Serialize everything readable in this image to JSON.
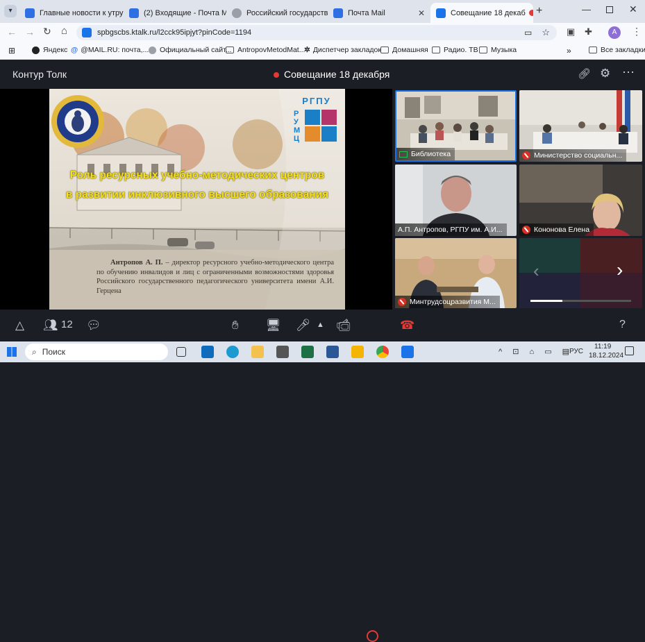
{
  "browser": {
    "tabs": [
      {
        "title": "Главные новости к утру",
        "color": "#2f6fe4",
        "active": false
      },
      {
        "title": "(2) Входящие - Почта M",
        "color": "#2f6fe4",
        "active": false
      },
      {
        "title": "Российский государстве",
        "color": "#888",
        "active": false
      },
      {
        "title": "Почта Mail",
        "color": "#2f6fe4",
        "active": false
      },
      {
        "title": "Совещание 18 декаб",
        "color": "#1a73e8",
        "active": true
      }
    ],
    "url": "spbgscbs.ktalk.ru/l2cck95ipjyt?pinCode=1194",
    "profile_initial": "A",
    "bookmarks": [
      "Яндекс",
      "@MAIL.RU: почта,...",
      "Официальный сайт...",
      "AntropovMetodMat...",
      "Диспетчер закладок",
      "Домашняя",
      "Радио. ТВ",
      "Музыка"
    ],
    "bookmarks_overflow": "»",
    "all_bookmarks": "Все закладки"
  },
  "app": {
    "name": "Контур Толк",
    "meeting_title": "Совещание 18 декабря",
    "participants_count": "12"
  },
  "slide": {
    "logo_text": "РГПУ",
    "logo_sub": "РУМЦ",
    "title_line1": "Роль ресурсных учебно-методических центров",
    "title_line2": "в развитии инклюзивного высшего образования",
    "caption_name": "Антропов А. П.",
    "caption_text": " – директор ресурсного учебно-методического центра по обучению инвалидов и лиц с ограниченными возможностями здоровья Российского государственного педагогического университета имени А.И. Герцена"
  },
  "tiles": [
    {
      "label": "Библиотека",
      "muted": false
    },
    {
      "label": "Министерство социальн...",
      "muted": true
    },
    {
      "label": "А.П. Антропов, РГПУ им. А.И...",
      "muted": false
    },
    {
      "label": "Кононова Елена",
      "muted": true
    },
    {
      "label": "Минтрудсоцразвития М...",
      "muted": true
    }
  ],
  "taskbar": {
    "search_placeholder": "Поиск",
    "language": "РУС",
    "time": "11:19",
    "date": "18.12.2024"
  },
  "colors": {
    "accent": "#1a73e8",
    "record": "#e53935",
    "leave": "#e53935"
  }
}
